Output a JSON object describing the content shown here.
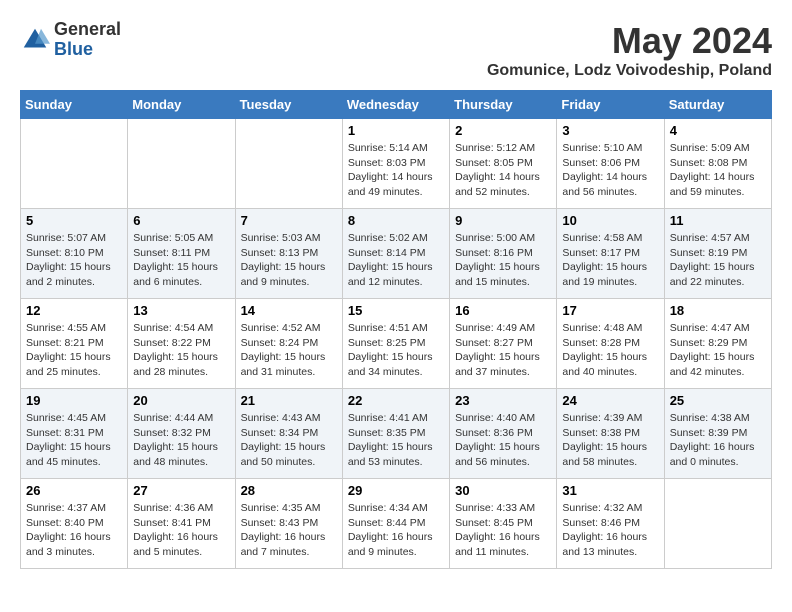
{
  "logo": {
    "general": "General",
    "blue": "Blue"
  },
  "title": "May 2024",
  "subtitle": "Gomunice, Lodz Voivodeship, Poland",
  "days_of_week": [
    "Sunday",
    "Monday",
    "Tuesday",
    "Wednesday",
    "Thursday",
    "Friday",
    "Saturday"
  ],
  "weeks": [
    [
      {
        "day": "",
        "info": ""
      },
      {
        "day": "",
        "info": ""
      },
      {
        "day": "",
        "info": ""
      },
      {
        "day": "1",
        "info": "Sunrise: 5:14 AM\nSunset: 8:03 PM\nDaylight: 14 hours\nand 49 minutes."
      },
      {
        "day": "2",
        "info": "Sunrise: 5:12 AM\nSunset: 8:05 PM\nDaylight: 14 hours\nand 52 minutes."
      },
      {
        "day": "3",
        "info": "Sunrise: 5:10 AM\nSunset: 8:06 PM\nDaylight: 14 hours\nand 56 minutes."
      },
      {
        "day": "4",
        "info": "Sunrise: 5:09 AM\nSunset: 8:08 PM\nDaylight: 14 hours\nand 59 minutes."
      }
    ],
    [
      {
        "day": "5",
        "info": "Sunrise: 5:07 AM\nSunset: 8:10 PM\nDaylight: 15 hours\nand 2 minutes."
      },
      {
        "day": "6",
        "info": "Sunrise: 5:05 AM\nSunset: 8:11 PM\nDaylight: 15 hours\nand 6 minutes."
      },
      {
        "day": "7",
        "info": "Sunrise: 5:03 AM\nSunset: 8:13 PM\nDaylight: 15 hours\nand 9 minutes."
      },
      {
        "day": "8",
        "info": "Sunrise: 5:02 AM\nSunset: 8:14 PM\nDaylight: 15 hours\nand 12 minutes."
      },
      {
        "day": "9",
        "info": "Sunrise: 5:00 AM\nSunset: 8:16 PM\nDaylight: 15 hours\nand 15 minutes."
      },
      {
        "day": "10",
        "info": "Sunrise: 4:58 AM\nSunset: 8:17 PM\nDaylight: 15 hours\nand 19 minutes."
      },
      {
        "day": "11",
        "info": "Sunrise: 4:57 AM\nSunset: 8:19 PM\nDaylight: 15 hours\nand 22 minutes."
      }
    ],
    [
      {
        "day": "12",
        "info": "Sunrise: 4:55 AM\nSunset: 8:21 PM\nDaylight: 15 hours\nand 25 minutes."
      },
      {
        "day": "13",
        "info": "Sunrise: 4:54 AM\nSunset: 8:22 PM\nDaylight: 15 hours\nand 28 minutes."
      },
      {
        "day": "14",
        "info": "Sunrise: 4:52 AM\nSunset: 8:24 PM\nDaylight: 15 hours\nand 31 minutes."
      },
      {
        "day": "15",
        "info": "Sunrise: 4:51 AM\nSunset: 8:25 PM\nDaylight: 15 hours\nand 34 minutes."
      },
      {
        "day": "16",
        "info": "Sunrise: 4:49 AM\nSunset: 8:27 PM\nDaylight: 15 hours\nand 37 minutes."
      },
      {
        "day": "17",
        "info": "Sunrise: 4:48 AM\nSunset: 8:28 PM\nDaylight: 15 hours\nand 40 minutes."
      },
      {
        "day": "18",
        "info": "Sunrise: 4:47 AM\nSunset: 8:29 PM\nDaylight: 15 hours\nand 42 minutes."
      }
    ],
    [
      {
        "day": "19",
        "info": "Sunrise: 4:45 AM\nSunset: 8:31 PM\nDaylight: 15 hours\nand 45 minutes."
      },
      {
        "day": "20",
        "info": "Sunrise: 4:44 AM\nSunset: 8:32 PM\nDaylight: 15 hours\nand 48 minutes."
      },
      {
        "day": "21",
        "info": "Sunrise: 4:43 AM\nSunset: 8:34 PM\nDaylight: 15 hours\nand 50 minutes."
      },
      {
        "day": "22",
        "info": "Sunrise: 4:41 AM\nSunset: 8:35 PM\nDaylight: 15 hours\nand 53 minutes."
      },
      {
        "day": "23",
        "info": "Sunrise: 4:40 AM\nSunset: 8:36 PM\nDaylight: 15 hours\nand 56 minutes."
      },
      {
        "day": "24",
        "info": "Sunrise: 4:39 AM\nSunset: 8:38 PM\nDaylight: 15 hours\nand 58 minutes."
      },
      {
        "day": "25",
        "info": "Sunrise: 4:38 AM\nSunset: 8:39 PM\nDaylight: 16 hours\nand 0 minutes."
      }
    ],
    [
      {
        "day": "26",
        "info": "Sunrise: 4:37 AM\nSunset: 8:40 PM\nDaylight: 16 hours\nand 3 minutes."
      },
      {
        "day": "27",
        "info": "Sunrise: 4:36 AM\nSunset: 8:41 PM\nDaylight: 16 hours\nand 5 minutes."
      },
      {
        "day": "28",
        "info": "Sunrise: 4:35 AM\nSunset: 8:43 PM\nDaylight: 16 hours\nand 7 minutes."
      },
      {
        "day": "29",
        "info": "Sunrise: 4:34 AM\nSunset: 8:44 PM\nDaylight: 16 hours\nand 9 minutes."
      },
      {
        "day": "30",
        "info": "Sunrise: 4:33 AM\nSunset: 8:45 PM\nDaylight: 16 hours\nand 11 minutes."
      },
      {
        "day": "31",
        "info": "Sunrise: 4:32 AM\nSunset: 8:46 PM\nDaylight: 16 hours\nand 13 minutes."
      },
      {
        "day": "",
        "info": ""
      }
    ]
  ]
}
